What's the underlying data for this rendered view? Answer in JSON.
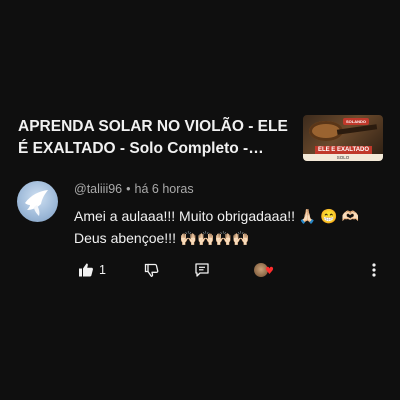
{
  "video": {
    "title": "APRENDA SOLAR NO VIOLÃO - ELE É EXALTADO - Solo Completo - LEVÍTICOS",
    "thumbnail": {
      "badge": "SOLANDO",
      "banner": "ELE E EXALTADO",
      "subtitle": "SOLO"
    }
  },
  "comment": {
    "author": "@taliii96",
    "separator": "•",
    "time": "há 6 horas",
    "line1": "Amei a aulaaa!!! Muito obrigadaaa!! 🙏🏻 😁 🫶🏻",
    "line2": "Deus abençoe!!! 🙌🏻🙌🏻🙌🏻🙌🏻",
    "like_count": "1"
  },
  "icons": {
    "like": "thumbs-up-icon",
    "dislike": "thumbs-down-icon",
    "reply": "reply-icon",
    "creator_heart": "creator-heart-icon",
    "more": "more-vertical-icon"
  },
  "colors": {
    "background": "#0f0f0f",
    "text_primary": "#f1f1f1",
    "text_secondary": "#aaaaaa",
    "heart": "#ff2d2d"
  }
}
